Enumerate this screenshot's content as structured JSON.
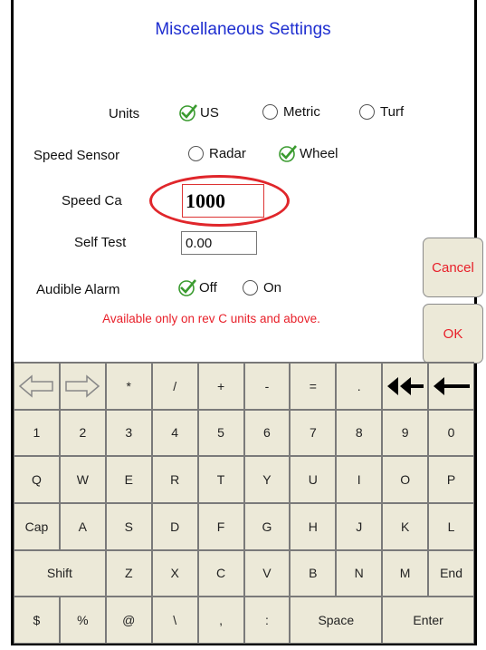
{
  "title": "Miscellaneous Settings",
  "units": {
    "label": "Units",
    "options": [
      "US",
      "Metric",
      "Turf"
    ],
    "selected": "US"
  },
  "speed_sensor": {
    "label": "Speed Sensor",
    "options": [
      "Radar",
      "Wheel"
    ],
    "selected": "Wheel"
  },
  "speed_cal": {
    "label": "Speed Ca",
    "value": "1000"
  },
  "self_test": {
    "label": "Self Test",
    "value": "0.00"
  },
  "audible_alarm": {
    "label": "Audible Alarm",
    "options": [
      "Off",
      "On"
    ],
    "selected": "Off"
  },
  "note": "Available only on rev C units and above.",
  "buttons": {
    "cancel": "Cancel",
    "ok": "OK"
  },
  "keyboard": {
    "row1": [
      "⇦",
      "⇨",
      "*",
      "/",
      "+",
      "-",
      "=",
      ".",
      "←←",
      "←"
    ],
    "row2": [
      "1",
      "2",
      "3",
      "4",
      "5",
      "6",
      "7",
      "8",
      "9",
      "0"
    ],
    "row3": [
      "Q",
      "W",
      "E",
      "R",
      "T",
      "Y",
      "U",
      "I",
      "O",
      "P"
    ],
    "row4": [
      "Cap",
      "A",
      "S",
      "D",
      "F",
      "G",
      "H",
      "J",
      "K",
      "L"
    ],
    "row5": [
      "Shift",
      "Z",
      "X",
      "C",
      "V",
      "B",
      "N",
      "M",
      "End"
    ],
    "row6": [
      "$",
      "%",
      "@",
      "\\",
      ",",
      ":",
      "Space",
      "Enter"
    ]
  },
  "colors": {
    "title": "#1f2fd0",
    "note": "#e8202a",
    "key_bg": "#ece9d8",
    "highlight": "#e0262b",
    "check": "#3a9b2f"
  }
}
